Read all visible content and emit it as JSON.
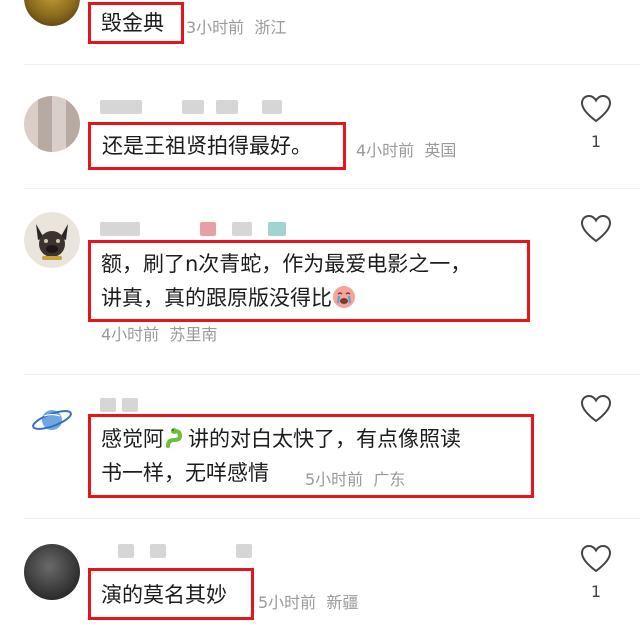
{
  "comments": [
    {
      "text": "毁金典",
      "time_fragment": "3小时前",
      "location": "浙江",
      "avatar_icon": "snake-avatar"
    },
    {
      "text": "还是王祖贤拍得最好。",
      "time": "4小时前",
      "location": "英国",
      "likes": "1",
      "avatar_icon": "blurred-avatar"
    },
    {
      "text_line1": "额，刷了n次青蛇，作为最爱电影之一，",
      "text_line2": "讲真，真的跟原版没得比",
      "text_emoji": "crying-face-emoji",
      "time": "4小时前",
      "location": "苏里南",
      "avatar_icon": "dog-avatar"
    },
    {
      "text_line1_a": "感觉阿",
      "text_line1_b": "讲的对白太快了，有点像照读",
      "text_line2": "书一样，无咩感情",
      "inline_emoji": "snake-emoji",
      "time": "5小时前",
      "location": "广东",
      "avatar_icon": "saturn-planet-icon"
    },
    {
      "text": "演的莫名其妙",
      "time": "5小时前",
      "location": "新疆",
      "likes": "1",
      "avatar_icon": "dark-photo-avatar"
    }
  ],
  "colors": {
    "highlight": "#e8141c",
    "meta": "#9a9a9a",
    "text": "#1c1c1c"
  }
}
